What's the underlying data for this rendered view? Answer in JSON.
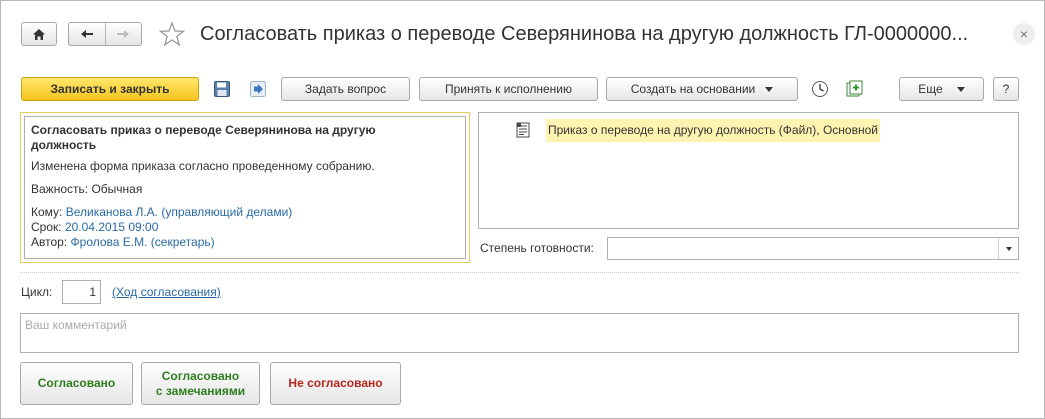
{
  "window": {
    "title": "Согласовать приказ о переводе Северянинова на другую должность ГЛ-0000000...",
    "close_glyph": "×"
  },
  "toolbar": {
    "save_close": "Записать и закрыть",
    "ask_question": "Задать вопрос",
    "accept": "Принять к исполнению",
    "create_based": "Создать на основании",
    "more": "Еще",
    "help": "?"
  },
  "task": {
    "title": "Согласовать приказ о переводе Северянинова на другую должность",
    "description": "Изменена форма приказа согласно проведенному собранию.",
    "importance_label": "Важность:",
    "importance_value": "Обычная",
    "to_label": "Кому:",
    "to_value": "Великанова Л.А. (управляющий делами)",
    "deadline_label": "Срок:",
    "deadline_value": "20.04.2015 09:00",
    "author_label": "Автор:",
    "author_value": "Фролова Е.М. (секретарь)"
  },
  "files": {
    "items": [
      {
        "label": "Приказ о переводе на другую должность (Файл), Основной",
        "icon": "document-icon"
      }
    ]
  },
  "readiness": {
    "label": "Степень готовности:",
    "value": ""
  },
  "cycle": {
    "label": "Цикл:",
    "value": "1",
    "route_link": "(Ход согласования)"
  },
  "comment": {
    "placeholder": "Ваш комментарий"
  },
  "decisions": {
    "approved": "Согласовано",
    "approved_remarks_line1": "Согласовано",
    "approved_remarks_line2": "с замечаниями",
    "rejected": "Не согласовано"
  },
  "colors": {
    "primary_button": "#f5c520",
    "link": "#2a6aa5",
    "approve_text": "#2e7d1e",
    "reject_text": "#b5261e",
    "file_highlight": "#fcf4b0"
  }
}
